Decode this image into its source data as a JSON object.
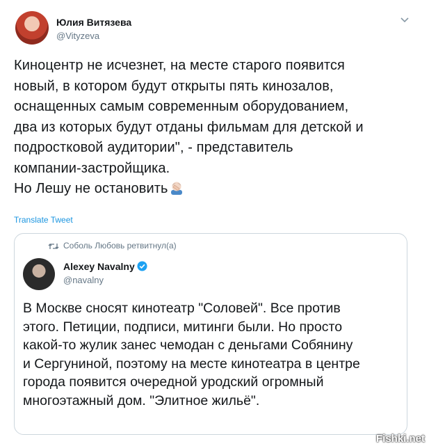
{
  "author": {
    "name": "Юлия Витязева",
    "handle": "@Vityzeva"
  },
  "tweet_lines": [
    "Киноцентр не исчезнет, на месте старого появится",
    "новый, в котором будут открыты пять кинозалов,",
    "оснащенных самым современным оборудованием,",
    "два из которых будут отданы фильмам для детской и",
    "подростковой аудитории\", - представитель",
    "компании-застройщика.",
    "Но Лешу не остановить"
  ],
  "translate_label": "Translate Tweet",
  "quoted": {
    "retweet_context": "Соболь Любовь ретвитнул(а)",
    "name": "Alexey Navalny",
    "handle": "@navalny",
    "lines": [
      "В Москве сносят кинотеатр \"Соловей\". Все против",
      "этого. Петиции, подписи, митинги были. Но просто",
      "какой-то жулик занес чемодан с деньгами Собянину",
      "и Сергуниной, поэтому на месте кинотеатра в центре",
      "города появится очередной уродский огромный",
      "многоэтажный дом. \"Элитное жильё\"."
    ]
  },
  "icons": {
    "caret": "chevron-down-icon",
    "emoji": "facepalm-emoji-icon",
    "retweet": "retweet-icon",
    "verified": "verified-badge-icon"
  },
  "colors": {
    "link": "#1b95e0",
    "secondary": "#657786",
    "border": "#ccd6dd",
    "verified": "#1da1f2"
  },
  "watermark": "Fishki.net"
}
